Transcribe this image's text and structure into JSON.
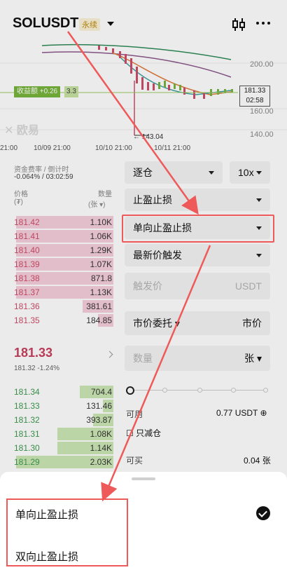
{
  "header": {
    "symbol": "SOLUSDT",
    "badge": "永续",
    "icons": [
      "chevron-down-icon",
      "candlestick-icon",
      "more-icon"
    ]
  },
  "chart": {
    "price_labels": [
      "200.00",
      "160.00",
      "140.00"
    ],
    "current_price": "181.33",
    "countdown": "02:58",
    "pnl_label": "收益额 +0.26",
    "leverage": "3.3",
    "watermark": "欧易",
    "low_marker": "143.04",
    "time_labels": [
      "21:00",
      "10/09 21:00",
      "10/10 21:00",
      "10/11 21:00"
    ]
  },
  "orderbook": {
    "funding_label": "资金费率 / 倒计时",
    "funding_value": "-0.064% / 03:02:59",
    "col_price": "价格",
    "col_price_unit": "(₮)",
    "col_qty": "数量",
    "col_qty_unit": "(张 ▾)",
    "asks": [
      {
        "price": "181.42",
        "qty": "1.10K",
        "depth": 0.95
      },
      {
        "price": "181.41",
        "qty": "1.06K",
        "depth": 0.95
      },
      {
        "price": "181.40",
        "qty": "1.29K",
        "depth": 0.95
      },
      {
        "price": "181.39",
        "qty": "1.07K",
        "depth": 0.95
      },
      {
        "price": "181.38",
        "qty": "871.8",
        "depth": 0.95
      },
      {
        "price": "181.37",
        "qty": "1.13K",
        "depth": 0.95
      },
      {
        "price": "181.36",
        "qty": "381.61",
        "depth": 0.3
      },
      {
        "price": "181.35",
        "qty": "184.85",
        "depth": 0.15
      }
    ],
    "last_price": "181.33",
    "last_sub": "181.32  -1.24%",
    "bids": [
      {
        "price": "181.34",
        "qty": "704.4",
        "depth": 0.33
      },
      {
        "price": "181.33",
        "qty": "131.46",
        "depth": 0.1
      },
      {
        "price": "181.32",
        "qty": "393.87",
        "depth": 0.2
      },
      {
        "price": "181.31",
        "qty": "1.08K",
        "depth": 0.55
      },
      {
        "price": "181.30",
        "qty": "1.14K",
        "depth": 0.55
      },
      {
        "price": "181.29",
        "qty": "2.03K",
        "depth": 0.95
      }
    ]
  },
  "form": {
    "margin_mode": "逐仓",
    "leverage": "10x",
    "order_type": "止盈止损",
    "tpsl_mode": "单向止盈止损",
    "trigger_type": "最新价触发",
    "trigger_price_placeholder": "触发价",
    "trigger_price_unit": "USDT",
    "order_kind": "市价委托",
    "order_kind_value": "市价",
    "quantity_placeholder": "数量",
    "quantity_unit": "张",
    "available_label": "可用",
    "available_value": "0.77 USDT",
    "reduce_only": "只减仓",
    "can_buy_label": "可买",
    "can_buy_value": "0.04 张",
    "slider_value_percent": 0
  },
  "sheet": {
    "options": [
      "单向止盈止损",
      "双向止盈止损"
    ],
    "selected": "单向止盈止损"
  },
  "colors": {
    "ask": "#d04d6a",
    "bid": "#3d9a4f",
    "highlight": "#ee5a5a"
  }
}
